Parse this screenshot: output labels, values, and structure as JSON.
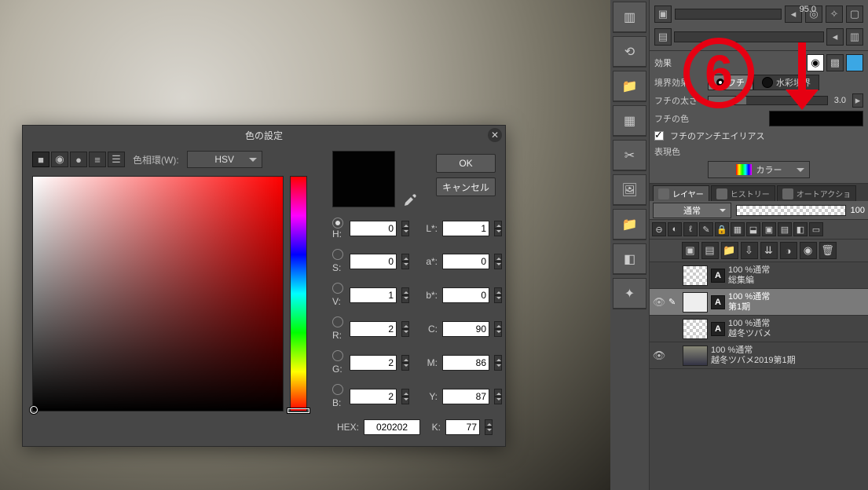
{
  "annotation": {
    "step_number": "6"
  },
  "dialog": {
    "title": "色の設定",
    "wheel_label": "色相環(W):",
    "model": "HSV",
    "ok": "OK",
    "cancel": "キャンセル",
    "hex_label": "HEX:",
    "hex_value": "020202",
    "hsv": {
      "H": "0",
      "S": "0",
      "V": "1"
    },
    "lab": {
      "L": "1",
      "a": "0",
      "b": "0"
    },
    "rgb": {
      "R": "2",
      "G": "2",
      "B": "2"
    },
    "cmyk": {
      "C": "90",
      "M": "86",
      "Y": "87",
      "K": "77"
    },
    "labels": {
      "H": "H:",
      "S": "S:",
      "V": "V:",
      "R": "R:",
      "G": "G:",
      "B": "B:",
      "L": "L*:",
      "a": "a*:",
      "b": "b*:",
      "C": "C:",
      "M": "M:",
      "Y": "Y:",
      "K": "K:"
    }
  },
  "tool_property": {
    "value": "95.0",
    "section_title": "効果"
  },
  "border_effect": {
    "label": "境界効果",
    "edge": "フチ",
    "watercolor": "水彩境界",
    "thickness_label": "フチの太さ",
    "thickness_value": "3.0",
    "color_label": "フチの色",
    "antialias_label": "フチのアンチエイリアス",
    "express_label": "表現色",
    "express_value": "カラー"
  },
  "layer_panel": {
    "tabs": {
      "layer": "レイヤー",
      "history": "ヒストリー",
      "auto": "オートアクショ"
    },
    "blend_mode": "通常",
    "opacity": "100"
  },
  "layers": [
    {
      "opacity": "100 %通常",
      "name": "総集編",
      "text": true,
      "visible": false
    },
    {
      "opacity": "100 %通常",
      "name": "第1期",
      "text": true,
      "visible": true,
      "selected": true
    },
    {
      "opacity": "100 %通常",
      "name": "越冬ツバメ",
      "text": true,
      "visible": false
    },
    {
      "opacity": "100 %通常",
      "name": "越冬ツバメ2019第1期",
      "text": false,
      "visible": true
    }
  ]
}
